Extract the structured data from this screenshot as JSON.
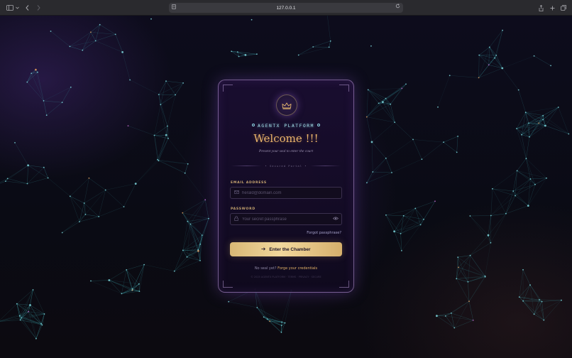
{
  "browser": {
    "url": "127.0.0.1",
    "icons": {
      "sidebar": "sidebar-icon",
      "back": "chevron-left-icon",
      "forward": "chevron-right-icon",
      "page": "page-icon",
      "reload": "reload-icon",
      "share": "share-icon",
      "new_tab": "plus-icon",
      "tabs": "tabs-icon"
    }
  },
  "login": {
    "crest_icon": "crown-icon",
    "platform": "AGENTX PLATFORM",
    "title": "Welcome !!!",
    "subtitle": "Present your seal to enter the court",
    "divider": "• Secured Portal •",
    "email": {
      "label": "EMAIL ADDRESS",
      "placeholder": "herald@domain.com",
      "value": "",
      "icon": "mail-icon"
    },
    "password": {
      "label": "PASSWORD",
      "placeholder": "Your secret passphrase",
      "value": "",
      "icon": "lock-icon",
      "toggle_icon": "eye-icon"
    },
    "forgot": "Forgot passphrase?",
    "submit": {
      "label": "Enter the Chamber",
      "icon": "arrow-right-icon"
    },
    "signup_prompt": "No seal yet?",
    "signup_link": "Forge your credentials",
    "footer": "© 2025 AGENTX PLATFORM · TERMS · PRIVACY · SECURE"
  },
  "colors": {
    "accent_gold": "#e8b36a",
    "accent_cyan": "#a8e2ec",
    "card_border": "#c4a0e6",
    "network_line": "#3fb0b8"
  }
}
